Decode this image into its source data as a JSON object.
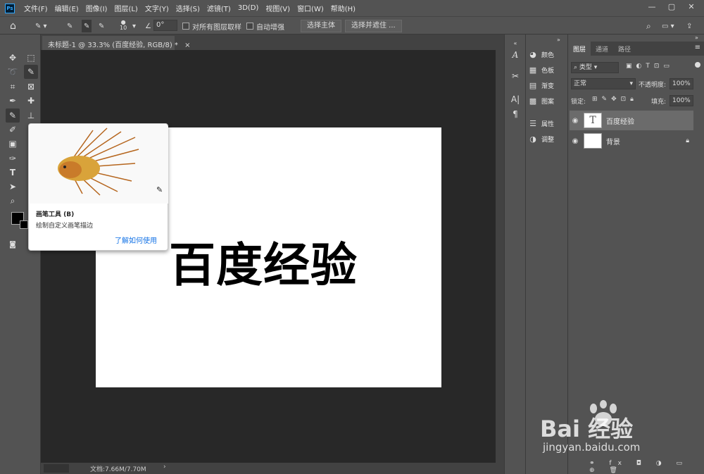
{
  "app": {
    "logo": "Ps"
  },
  "menu": [
    "文件(F)",
    "编辑(E)",
    "图像(I)",
    "图层(L)",
    "文字(Y)",
    "选择(S)",
    "滤镜(T)",
    "3D(D)",
    "视图(V)",
    "窗口(W)",
    "帮助(H)"
  ],
  "window_controls": [
    "—",
    "▢",
    "✕"
  ],
  "options": {
    "brush_size": "10",
    "angle": "0°",
    "sample_all_layers": "对所有图层取样",
    "auto_enhance": "自动增强",
    "select_subject": "选择主体",
    "select_and_mask": "选择并遮住 ..."
  },
  "document": {
    "tab_title": "未标题-1 @ 33.3% (百度经验, RGB/8) *",
    "canvas_text": "百度经验",
    "status": "文档:7.66M/7.70M"
  },
  "tooltip": {
    "title": "画笔工具 (B)",
    "desc": "绘制自定义画笔描边",
    "link": "了解如何使用"
  },
  "mid_panel": {
    "items": [
      "颜色",
      "色板",
      "渐变",
      "图案",
      "属性",
      "调整"
    ]
  },
  "layers_panel": {
    "tabs": [
      "图层",
      "通道",
      "路径"
    ],
    "filter": "类型",
    "blend_mode": "正常",
    "opacity_label": "不透明度:",
    "opacity": "100%",
    "lock_label": "锁定:",
    "fill_label": "填充:",
    "fill": "100%",
    "layers": [
      {
        "name": "百度经验",
        "type": "text"
      },
      {
        "name": "背景",
        "type": "background"
      }
    ]
  },
  "watermark": {
    "brand": "Bai 经验",
    "url": "jingyan.baidu.com"
  }
}
